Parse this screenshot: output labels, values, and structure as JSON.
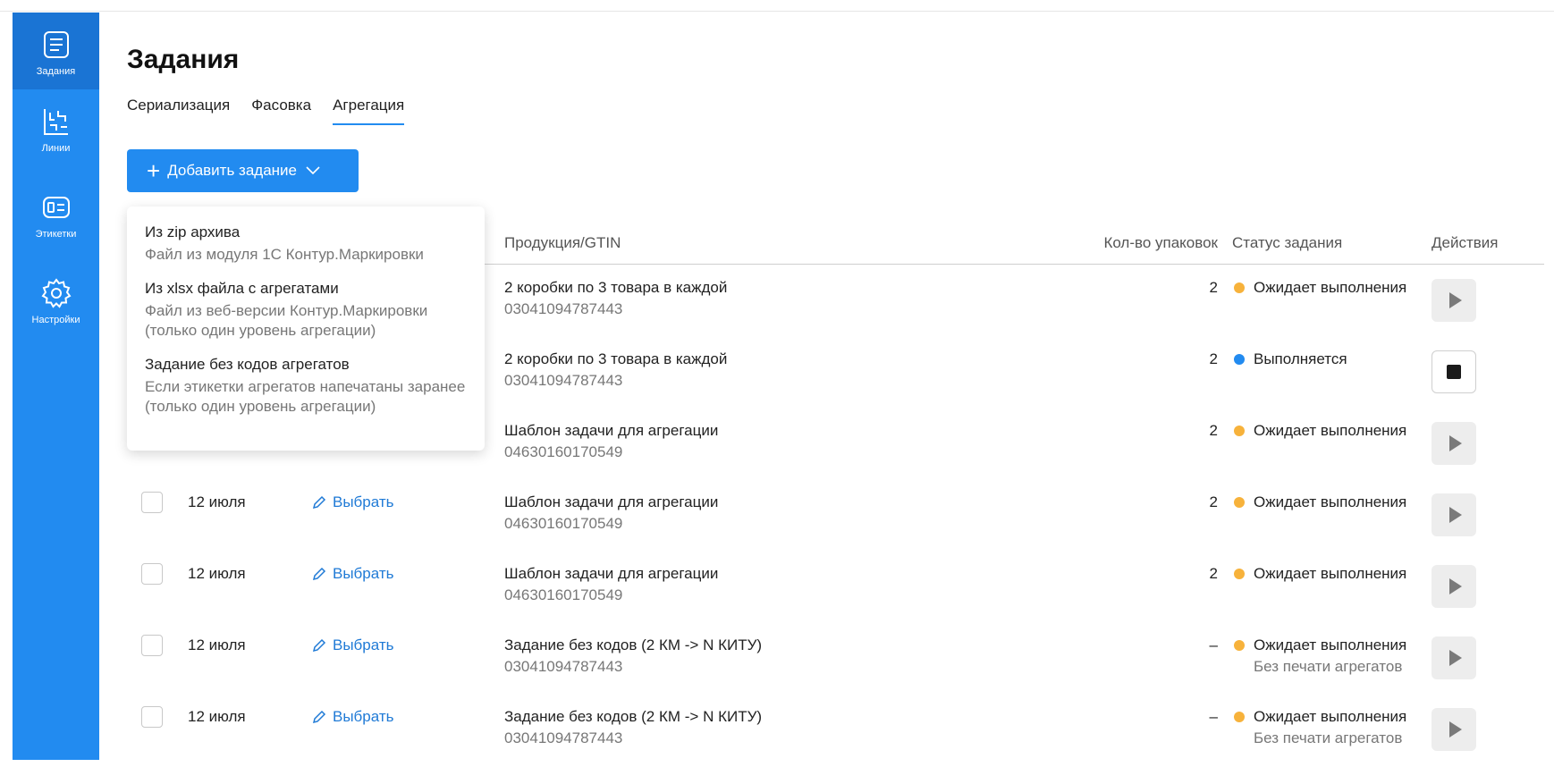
{
  "sidebar": {
    "items": [
      {
        "label": "Задания",
        "icon": "tasks-icon"
      },
      {
        "label": "Линии",
        "icon": "lines-icon"
      },
      {
        "label": "Этикетки",
        "icon": "labels-icon"
      },
      {
        "label": "Настройки",
        "icon": "gear-icon"
      }
    ]
  },
  "page": {
    "title": "Задания"
  },
  "tabs": [
    {
      "label": "Сериализация"
    },
    {
      "label": "Фасовка"
    },
    {
      "label": "Агрегация"
    }
  ],
  "add_button": {
    "label": "Добавить задание"
  },
  "dropdown": {
    "items": [
      {
        "title": "Из zip архива",
        "desc": "Файл из модуля 1С Контур.Маркировки"
      },
      {
        "title": "Из xlsx файла с агрегатами",
        "desc": "Файл из веб-версии Контур.Маркировки (только один уровень агрегации)"
      },
      {
        "title": "Задание без кодов агрегатов",
        "desc": "Если этикетки агрегатов напечатаны заранее (только один уровень агрегации)"
      }
    ]
  },
  "table": {
    "headers": {
      "product": "Продукция/GTIN",
      "qty": "Кол-во упаковок",
      "status": "Статус задания",
      "actions": "Действия"
    },
    "rows": [
      {
        "date": "",
        "pick": "",
        "name": "2 коробки по 3 товара в каждой",
        "gtin": "03041094787443",
        "qty": "2",
        "status": "Ожидает выполнения",
        "sub": "",
        "action": "play"
      },
      {
        "date": "",
        "pick": "",
        "name": "2 коробки по 3 товара в каждой",
        "gtin": "03041094787443",
        "qty": "2",
        "status": "Выполняется",
        "sub": "",
        "action": "stop"
      },
      {
        "date": "",
        "pick": "",
        "name": "Шаблон задачи для агрегации",
        "gtin": "04630160170549",
        "qty": "2",
        "status": "Ожидает выполнения",
        "sub": "",
        "action": "play"
      },
      {
        "date": "12 июля",
        "pick": "Выбрать",
        "name": "Шаблон задачи для агрегации",
        "gtin": "04630160170549",
        "qty": "2",
        "status": "Ожидает выполнения",
        "sub": "",
        "action": "play"
      },
      {
        "date": "12 июля",
        "pick": "Выбрать",
        "name": "Шаблон задачи для агрегации",
        "gtin": "04630160170549",
        "qty": "2",
        "status": "Ожидает выполнения",
        "sub": "",
        "action": "play"
      },
      {
        "date": "12 июля",
        "pick": "Выбрать",
        "name": "Задание без кодов (2 КМ -> N КИТУ)",
        "gtin": "03041094787443",
        "qty": "–",
        "status": "Ожидает выполнения",
        "sub": "Без печати агрегатов",
        "action": "play"
      },
      {
        "date": "12 июля",
        "pick": "Выбрать",
        "name": "Задание без кодов (2 КМ -> N КИТУ)",
        "gtin": "03041094787443",
        "qty": "–",
        "status": "Ожидает выполнения",
        "sub": "Без печати агрегатов",
        "action": "play"
      }
    ]
  },
  "colors": {
    "accent": "#228bf0",
    "waiting": "#f7b23b",
    "running": "#228bf0"
  }
}
